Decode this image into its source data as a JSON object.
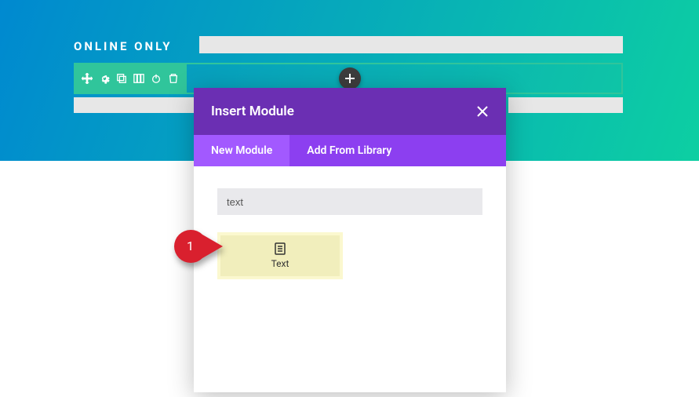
{
  "section_label": "ONLINE ONLY",
  "modal": {
    "title": "Insert Module",
    "tabs": {
      "new": "New Module",
      "library": "Add From Library"
    },
    "search_value": "text"
  },
  "modules": [
    {
      "label": "Text"
    }
  ],
  "annotation": {
    "step": "1"
  },
  "icons": {
    "toolbar": [
      "move",
      "settings",
      "duplicate",
      "columns",
      "power",
      "delete"
    ]
  }
}
